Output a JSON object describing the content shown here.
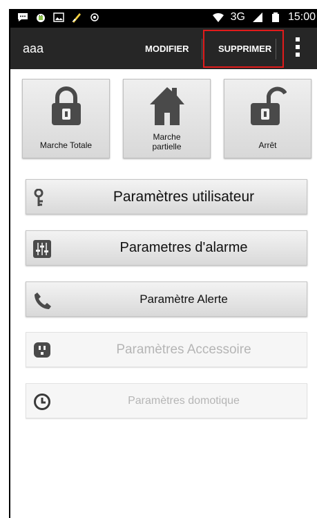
{
  "status": {
    "network": "3G",
    "time": "15:00"
  },
  "appbar": {
    "title": "aaa",
    "modifier": "MODIFIER",
    "supprimer": "SUPPRIMER"
  },
  "modes": {
    "total": "Marche Totale",
    "partial_line1": "Marche",
    "partial_line2": "partielle",
    "stop": "Arrêt"
  },
  "menu": {
    "user": "Paramètres utilisateur",
    "alarm": "Parametres d'alarme",
    "alert": "Paramètre Alerte",
    "accessory": "Paramètres Accessoire",
    "domotic": "Paramètres domotique"
  },
  "colors": {
    "highlight": "#e21b1b",
    "appbar": "#262626",
    "icon": "#4a4a4a"
  }
}
